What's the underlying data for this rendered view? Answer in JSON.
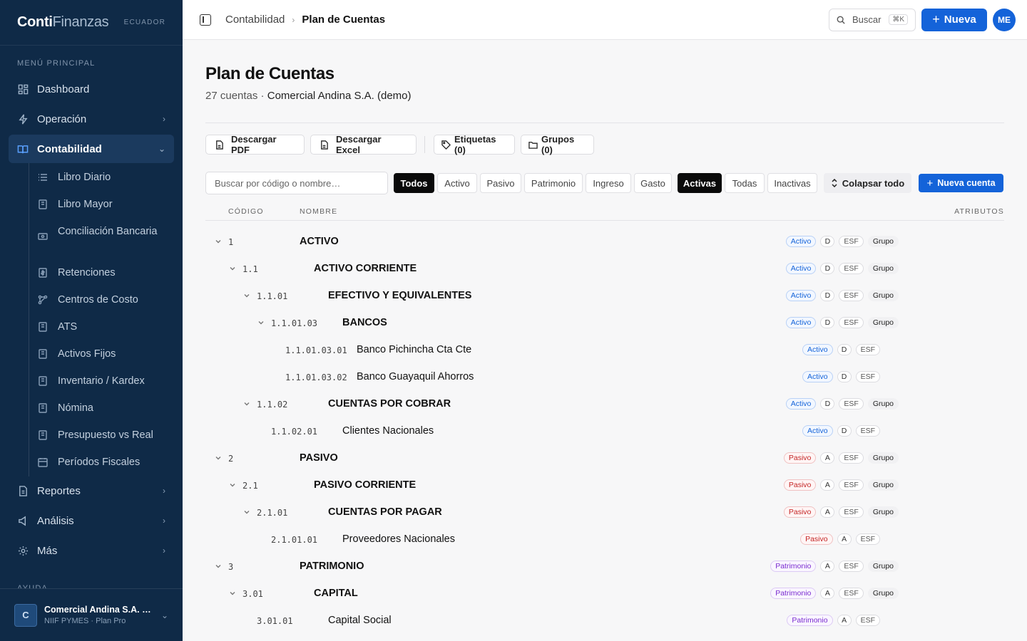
{
  "brand": {
    "name_bold": "Conti",
    "name_light": "Finanzas",
    "country": "ECUADOR"
  },
  "sidebar": {
    "section_main": "MENÚ PRINCIPAL",
    "section_help": "AYUDA",
    "items": [
      {
        "label": "Dashboard",
        "icon": "dashboard-icon"
      },
      {
        "label": "Operación",
        "icon": "bolt-icon"
      },
      {
        "label": "Contabilidad",
        "icon": "book-icon"
      },
      {
        "label": "Reportes",
        "icon": "document-icon"
      },
      {
        "label": "Análisis",
        "icon": "megaphone-icon"
      },
      {
        "label": "Más",
        "icon": "gear-icon"
      }
    ],
    "subitems": [
      {
        "label": "Libro Diario",
        "icon": "list-icon"
      },
      {
        "label": "Libro Mayor",
        "icon": "ledger-icon"
      },
      {
        "label": "Conciliación Bancaria",
        "icon": "banknote-icon"
      },
      {
        "label": "Retenciones",
        "icon": "receipt-icon"
      },
      {
        "label": "Centros de Costo",
        "icon": "network-icon"
      },
      {
        "label": "ATS",
        "icon": "ledger-icon"
      },
      {
        "label": "Activos Fijos",
        "icon": "ledger-icon"
      },
      {
        "label": "Inventario / Kardex",
        "icon": "ledger-icon"
      },
      {
        "label": "Nómina",
        "icon": "ledger-icon"
      },
      {
        "label": "Presupuesto vs Real",
        "icon": "ledger-icon"
      },
      {
        "label": "Períodos Fiscales",
        "icon": "calendar-icon"
      }
    ],
    "org": {
      "initial": "C",
      "name": "Comercial Andina S.A. (demo)",
      "plan": "NIIF PYMES · Plan Pro"
    }
  },
  "topbar": {
    "breadcrumb_parent": "Contabilidad",
    "breadcrumb_current": "Plan de Cuentas",
    "search_label": "Buscar",
    "search_shortcut": "⌘K",
    "new_label": "Nueva",
    "user_initials": "ME"
  },
  "page": {
    "title": "Plan de Cuentas",
    "count": "27 cuentas",
    "company": "Comercial Andina S.A. (demo)",
    "btn_pdf": "Descargar PDF",
    "btn_excel": "Descargar Excel",
    "btn_tags": "Etiquetas (0)",
    "btn_groups": "Grupos (0)",
    "search_placeholder": "Buscar por código o nombre…",
    "type_filters": [
      "Todos",
      "Activo",
      "Pasivo",
      "Patrimonio",
      "Ingreso",
      "Gasto"
    ],
    "status_filters": [
      "Activas",
      "Todas",
      "Inactivas"
    ],
    "collapse_label": "Colapsar todo",
    "new_account_label": "Nueva cuenta",
    "columns": {
      "code": "CÓDIGO",
      "name": "NOMBRE",
      "attrs": "ATRIBUTOS"
    }
  },
  "accounts": [
    {
      "level": 0,
      "code": "1",
      "name": "ACTIVO",
      "group": true,
      "type": "Activo",
      "nature": "D",
      "stmt": "ESF",
      "group_label": "Grupo"
    },
    {
      "level": 1,
      "code": "1.1",
      "name": "ACTIVO CORRIENTE",
      "group": true,
      "type": "Activo",
      "nature": "D",
      "stmt": "ESF",
      "group_label": "Grupo"
    },
    {
      "level": 2,
      "code": "1.1.01",
      "name": "EFECTIVO Y EQUIVALENTES",
      "group": true,
      "type": "Activo",
      "nature": "D",
      "stmt": "ESF",
      "group_label": "Grupo"
    },
    {
      "level": 3,
      "code": "1.1.01.03",
      "name": "BANCOS",
      "group": true,
      "type": "Activo",
      "nature": "D",
      "stmt": "ESF",
      "group_label": "Grupo"
    },
    {
      "level": 4,
      "code": "1.1.01.03.01",
      "name": "Banco Pichincha Cta Cte",
      "group": false,
      "type": "Activo",
      "nature": "D",
      "stmt": "ESF"
    },
    {
      "level": 4,
      "code": "1.1.01.03.02",
      "name": "Banco Guayaquil Ahorros",
      "group": false,
      "type": "Activo",
      "nature": "D",
      "stmt": "ESF"
    },
    {
      "level": 2,
      "code": "1.1.02",
      "name": "CUENTAS POR COBRAR",
      "group": true,
      "type": "Activo",
      "nature": "D",
      "stmt": "ESF",
      "group_label": "Grupo"
    },
    {
      "level": 3,
      "code": "1.1.02.01",
      "name": "Clientes Nacionales",
      "group": false,
      "type": "Activo",
      "nature": "D",
      "stmt": "ESF"
    },
    {
      "level": 0,
      "code": "2",
      "name": "PASIVO",
      "group": true,
      "type": "Pasivo",
      "nature": "A",
      "stmt": "ESF",
      "group_label": "Grupo"
    },
    {
      "level": 1,
      "code": "2.1",
      "name": "PASIVO CORRIENTE",
      "group": true,
      "type": "Pasivo",
      "nature": "A",
      "stmt": "ESF",
      "group_label": "Grupo"
    },
    {
      "level": 2,
      "code": "2.1.01",
      "name": "CUENTAS POR PAGAR",
      "group": true,
      "type": "Pasivo",
      "nature": "A",
      "stmt": "ESF",
      "group_label": "Grupo"
    },
    {
      "level": 3,
      "code": "2.1.01.01",
      "name": "Proveedores Nacionales",
      "group": false,
      "type": "Pasivo",
      "nature": "A",
      "stmt": "ESF"
    },
    {
      "level": 0,
      "code": "3",
      "name": "PATRIMONIO",
      "group": true,
      "type": "Patrimonio",
      "nature": "A",
      "stmt": "ESF",
      "group_label": "Grupo"
    },
    {
      "level": 1,
      "code": "3.01",
      "name": "CAPITAL",
      "group": true,
      "type": "Patrimonio",
      "nature": "A",
      "stmt": "ESF",
      "group_label": "Grupo"
    },
    {
      "level": 2,
      "code": "3.01.01",
      "name": "Capital Social",
      "group": false,
      "type": "Patrimonio",
      "nature": "A",
      "stmt": "ESF"
    }
  ],
  "colors": {
    "sidebar_bg": "#0f2a47",
    "primary": "#1463d9",
    "activo": "#1463d9",
    "pasivo": "#c42525",
    "patrimonio": "#7a2bd0"
  }
}
